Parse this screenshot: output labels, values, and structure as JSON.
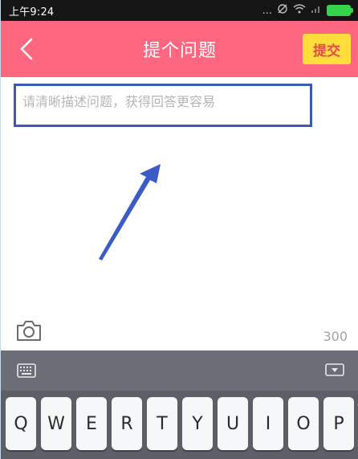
{
  "status_bar": {
    "time": "上午9:24",
    "icons": [
      "dots-icon",
      "sync-icon",
      "wifi-icon",
      "signal-icon",
      "battery-icon"
    ],
    "dots": "..."
  },
  "header": {
    "title": "提个问题",
    "submit_label": "提交",
    "colors": {
      "background": "#ff6680",
      "submit_bg": "#ffde3b",
      "submit_text": "#e64b4b"
    }
  },
  "compose": {
    "question_placeholder": "请清晰描述问题，获得回答更容易",
    "question_value": "",
    "char_limit": "300",
    "camera_icon": "camera-icon"
  },
  "keyboard": {
    "toolbar_left_icon": "keyboard-icon",
    "toolbar_right_icon": "hide-keyboard-icon",
    "keys": [
      "Q",
      "W",
      "E",
      "R",
      "T",
      "Y",
      "U",
      "I",
      "O",
      "P"
    ]
  }
}
